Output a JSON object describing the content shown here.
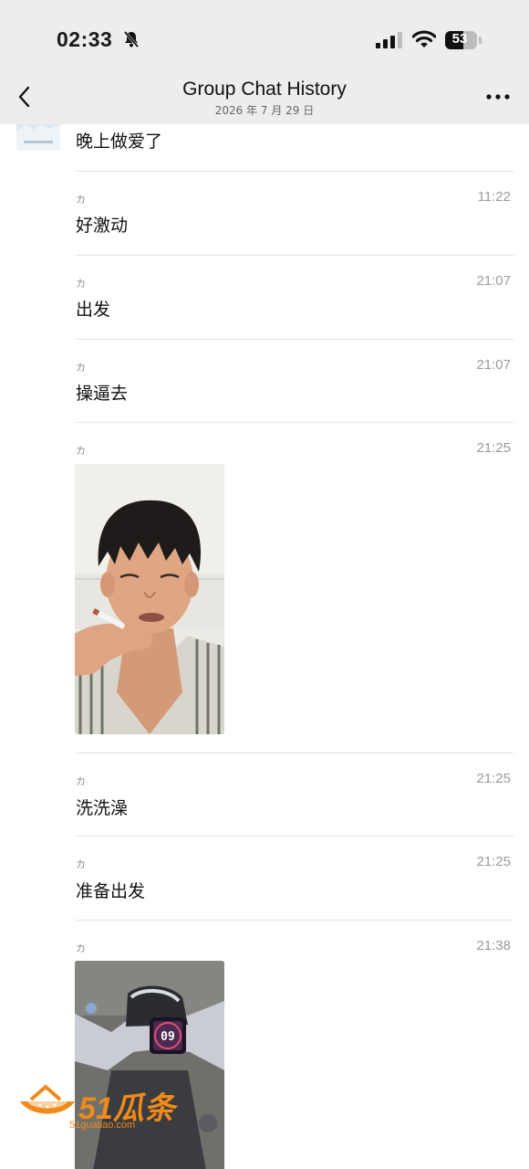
{
  "status": {
    "time": "02:33",
    "battery": "53"
  },
  "nav": {
    "title": "Group Chat History",
    "subtitle": "2026 年 7 月 29 日"
  },
  "messages": [
    {
      "text": "晚上做爱了"
    },
    {
      "sender": "カ",
      "time": "11:22",
      "text": "好激动"
    },
    {
      "sender": "カ",
      "time": "21:07",
      "text": "出发"
    },
    {
      "sender": "カ",
      "time": "21:07",
      "text": "操逼去"
    },
    {
      "sender": "カ",
      "time": "21:25",
      "type": "image"
    },
    {
      "sender": "カ",
      "time": "21:25",
      "text": "洗洗澡"
    },
    {
      "sender": "カ",
      "time": "21:25",
      "text": "准备出发"
    },
    {
      "sender": "カ",
      "time": "21:38",
      "type": "image"
    }
  ],
  "scooter_display": "09",
  "watermark": {
    "brand": "51瓜条",
    "url": "51guatiao.com"
  },
  "colors": {
    "bar": "#ededed",
    "watermark": "#f08a1a"
  }
}
